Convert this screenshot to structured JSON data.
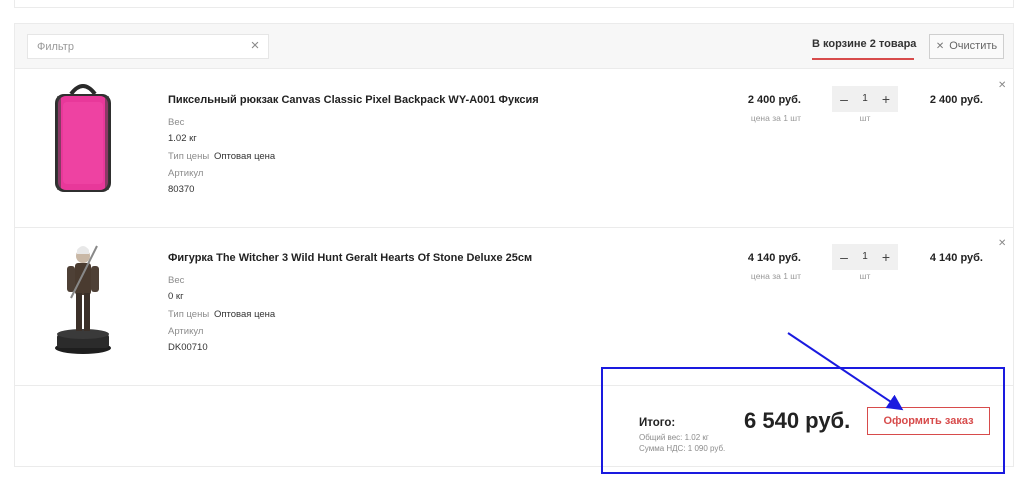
{
  "filter": {
    "placeholder": "Фильтр"
  },
  "tabs": {
    "in_cart": "В корзине 2 товара"
  },
  "clear_button": {
    "label": "Очистить"
  },
  "items": [
    {
      "name": "Пиксельный рюкзак Canvas Classic Pixel Backpack WY-A001 Фуксия",
      "weight_label": "Вес",
      "weight": "1.02 кг",
      "price_type_label": "Тип цены",
      "price_type": "Оптовая цена",
      "sku_label": "Артикул",
      "sku": "80370",
      "price": "2 400 руб.",
      "price_note": "цена за 1 шт",
      "quantity": "1",
      "unit": "шт",
      "total": "2 400 руб."
    },
    {
      "name": "Фигурка The Witcher 3 Wild Hunt Geralt Hearts Of Stone Deluxe 25см",
      "weight_label": "Вес",
      "weight": "0 кг",
      "price_type_label": "Тип цены",
      "price_type": "Оптовая цена",
      "sku_label": "Артикул",
      "sku": "DK00710",
      "price": "4 140 руб.",
      "price_note": "цена за 1 шт",
      "quantity": "1",
      "unit": "шт",
      "total": "4 140 руб."
    }
  ],
  "summary": {
    "title": "Итого:",
    "total_weight": "Общий вес: 1.02 кг",
    "vat": "Сумма НДС: 1 090 руб.",
    "amount": "6 540 руб.",
    "order_button": "Оформить заказ"
  },
  "colors": {
    "accent": "#d74b4b",
    "annotation": "#1a1adf",
    "backpack": "#e8389a"
  }
}
